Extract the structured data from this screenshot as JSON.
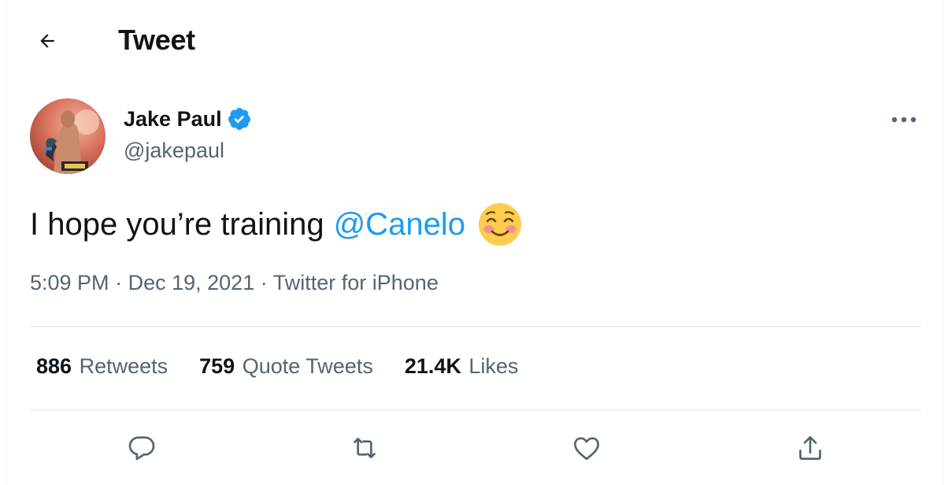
{
  "header": {
    "title": "Tweet",
    "back_icon": "arrow-left-icon"
  },
  "author": {
    "name": "Jake Paul",
    "handle": "@jakepaul",
    "verified": true,
    "verified_color": "#1d9bf0"
  },
  "tweet": {
    "text": "I hope you’re training",
    "mention": "@Canelo",
    "emoji": "smiling-face-with-smiling-eyes"
  },
  "meta": {
    "time": "5:09 PM",
    "separator": "·",
    "date": "Dec 19, 2021",
    "source": "Twitter for iPhone"
  },
  "stats": {
    "retweets_count": "886",
    "retweets_label": "Retweets",
    "quotes_count": "759",
    "quotes_label": "Quote Tweets",
    "likes_count": "21.4K",
    "likes_label": "Likes"
  },
  "actions": [
    "reply-icon",
    "retweet-icon",
    "like-icon",
    "share-icon"
  ],
  "colors": {
    "text": "#0f1419",
    "secondary": "#536471",
    "accent": "#1d9bf0",
    "divider": "#e1e8ed"
  }
}
